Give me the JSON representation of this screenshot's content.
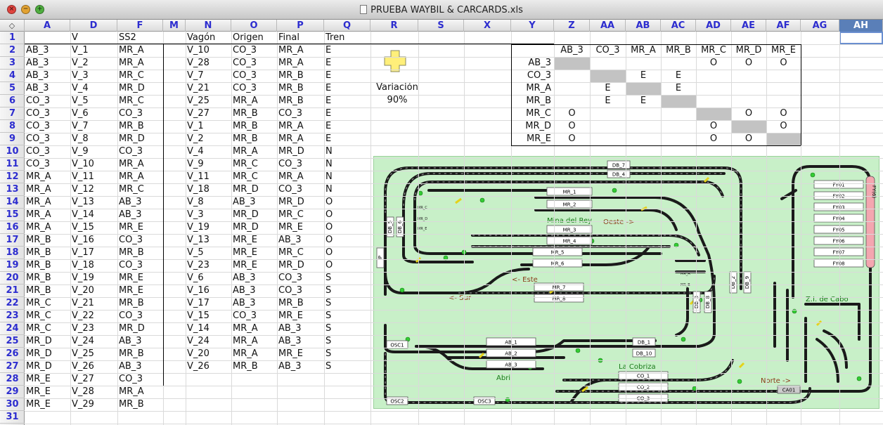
{
  "window": {
    "title": "PRUEBA WAYBIL & CARCARDS.xls"
  },
  "columns": [
    "A",
    "D",
    "F",
    "M",
    "N",
    "O",
    "P",
    "Q",
    "R",
    "S",
    "X",
    "Y",
    "Z",
    "AA",
    "AB",
    "AC",
    "AD",
    "AE",
    "AF",
    "AG",
    "AH"
  ],
  "rows": [
    "1",
    "2",
    "3",
    "4",
    "5",
    "6",
    "7",
    "8",
    "9",
    "10",
    "11",
    "12",
    "13",
    "14",
    "15",
    "16",
    "17",
    "18",
    "19",
    "20",
    "21",
    "22",
    "23",
    "24",
    "25",
    "26",
    "27",
    "28",
    "29",
    "30",
    "31"
  ],
  "headers": {
    "D": "V",
    "F": "SS2",
    "N": "Vagón",
    "O": "Origen",
    "P": "Final",
    "Q": "Tren"
  },
  "colA": [
    "AB_3",
    "AB_3",
    "AB_3",
    "AB_3",
    "CO_3",
    "CO_3",
    "CO_3",
    "CO_3",
    "CO_3",
    "CO_3",
    "MR_A",
    "MR_A",
    "MR_A",
    "MR_A",
    "MR_A",
    "MR_B",
    "MR_B",
    "MR_B",
    "MR_B",
    "MR_B",
    "MR_C",
    "MR_C",
    "MR_C",
    "MR_D",
    "MR_D",
    "MR_D",
    "MR_E",
    "MR_E",
    "MR_E"
  ],
  "colD": [
    "V_1",
    "V_2",
    "V_3",
    "V_4",
    "V_5",
    "V_6",
    "V_7",
    "V_8",
    "V_9",
    "V_10",
    "V_11",
    "V_12",
    "V_13",
    "V_14",
    "V_15",
    "V_16",
    "V_17",
    "V_18",
    "V_19",
    "V_20",
    "V_21",
    "V_22",
    "V_23",
    "V_24",
    "V_25",
    "V_26",
    "V_27",
    "V_28",
    "V_29"
  ],
  "colF": [
    "MR_A",
    "MR_A",
    "MR_C",
    "MR_D",
    "MR_C",
    "CO_3",
    "MR_B",
    "MR_D",
    "CO_3",
    "MR_A",
    "MR_A",
    "MR_C",
    "AB_3",
    "AB_3",
    "MR_E",
    "CO_3",
    "MR_B",
    "CO_3",
    "MR_E",
    "MR_E",
    "MR_B",
    "CO_3",
    "MR_D",
    "AB_3",
    "MR_B",
    "AB_3",
    "CO_3",
    "MR_A",
    "MR_B"
  ],
  "table": [
    [
      "V_10",
      "CO_3",
      "MR_A",
      "E"
    ],
    [
      "V_28",
      "CO_3",
      "MR_A",
      "E"
    ],
    [
      "V_7",
      "CO_3",
      "MR_B",
      "E"
    ],
    [
      "V_21",
      "CO_3",
      "MR_B",
      "E"
    ],
    [
      "V_25",
      "MR_A",
      "MR_B",
      "E"
    ],
    [
      "V_27",
      "MR_B",
      "CO_3",
      "E"
    ],
    [
      "V_1",
      "MR_B",
      "MR_A",
      "E"
    ],
    [
      "V_2",
      "MR_B",
      "MR_A",
      "E"
    ],
    [
      "V_4",
      "MR_A",
      "MR_D",
      "N"
    ],
    [
      "V_9",
      "MR_C",
      "CO_3",
      "N"
    ],
    [
      "V_11",
      "MR_C",
      "MR_A",
      "N"
    ],
    [
      "V_18",
      "MR_D",
      "CO_3",
      "N"
    ],
    [
      "V_8",
      "AB_3",
      "MR_D",
      "O"
    ],
    [
      "V_3",
      "MR_D",
      "MR_C",
      "O"
    ],
    [
      "V_19",
      "MR_D",
      "MR_E",
      "O"
    ],
    [
      "V_13",
      "MR_E",
      "AB_3",
      "O"
    ],
    [
      "V_5",
      "MR_E",
      "MR_C",
      "O"
    ],
    [
      "V_23",
      "MR_E",
      "MR_D",
      "O"
    ],
    [
      "V_6",
      "AB_3",
      "CO_3",
      "S"
    ],
    [
      "V_16",
      "AB_3",
      "CO_3",
      "S"
    ],
    [
      "V_17",
      "AB_3",
      "MR_B",
      "S"
    ],
    [
      "V_15",
      "CO_3",
      "MR_E",
      "S"
    ],
    [
      "V_14",
      "MR_A",
      "AB_3",
      "S"
    ],
    [
      "V_24",
      "MR_A",
      "AB_3",
      "S"
    ],
    [
      "V_20",
      "MR_A",
      "MR_E",
      "S"
    ],
    [
      "V_26",
      "MR_B",
      "AB_3",
      "S"
    ]
  ],
  "variacion": {
    "label": "Variación",
    "value": "90%"
  },
  "matrix": {
    "cols": [
      "AB_3",
      "CO_3",
      "MR_A",
      "MR_B",
      "MR_C",
      "MR_D",
      "MR_E"
    ],
    "rows": [
      {
        "name": "AB_3",
        "cells": [
          "",
          "",
          "",
          "",
          "O",
          "O",
          "O"
        ]
      },
      {
        "name": "CO_3",
        "cells": [
          "",
          "",
          "E",
          "E",
          "",
          "",
          ""
        ]
      },
      {
        "name": "MR_A",
        "cells": [
          "",
          "E",
          "",
          "E",
          "",
          "",
          ""
        ]
      },
      {
        "name": "MR_B",
        "cells": [
          "",
          "E",
          "E",
          "",
          "",
          "",
          ""
        ]
      },
      {
        "name": "MR_C",
        "cells": [
          "O",
          "",
          "",
          "",
          "",
          "O",
          "O"
        ]
      },
      {
        "name": "MR_D",
        "cells": [
          "O",
          "",
          "",
          "",
          "O",
          "",
          "O"
        ]
      },
      {
        "name": "MR_E",
        "cells": [
          "O",
          "",
          "",
          "",
          "O",
          "O",
          ""
        ]
      }
    ]
  },
  "layout": {
    "labels": {
      "mina": "Mina del Rey",
      "oeste": "Oeste ->",
      "este": "<- Este",
      "sur": "<- Sur",
      "cabo": "Z.I. de Cabo",
      "cobriza": "La Cobriza",
      "abril": "Abril",
      "norte": "Norte ->"
    },
    "sidings": {
      "mr1": "MR_1",
      "mr2": "MR_2",
      "mr3": "MR_3",
      "mr4": "MR_4",
      "mr5": "MR_5",
      "mr6": "MR_6",
      "mr7": "MR_7",
      "mr8": "MR_8",
      "ab1": "AB_1",
      "ab2": "AB_2",
      "ab3": "AB_3",
      "co1": "CO_1",
      "co2": "CO_2",
      "co3": "CO_3",
      "db1": "DB_1",
      "db10": "DB_10",
      "db7": "DB_7",
      "db4": "DB_4",
      "db5": "DB_5",
      "db6": "DB_6",
      "db2": "DB_2",
      "db9": "DB_9",
      "db3": "DB_3",
      "db8": "DB_8",
      "osc1": "OSC1",
      "osc2": "OSC2",
      "osc3": "OSC3",
      "ca01": "CA01",
      "fyl": "FY(6)",
      "ip": "IP"
    },
    "fy": [
      "FY01",
      "FY02",
      "FY03",
      "FY04",
      "FY05",
      "FY06",
      "FY07",
      "FY08"
    ],
    "small": {
      "mrc": "MR_C",
      "mrd": "MR_D",
      "mre": "MR_E",
      "mra": "MR_A",
      "mrb": "MR_B"
    }
  },
  "colors": {
    "header_text": "#2d2dcf",
    "selected_col": "#5a7fb8",
    "map_bg": "#c8f0c8",
    "siding_label": "#1a7a1a",
    "direction_label": "#8b3a1a",
    "signal": "#33cc33",
    "shade": "#c3c3c3"
  }
}
